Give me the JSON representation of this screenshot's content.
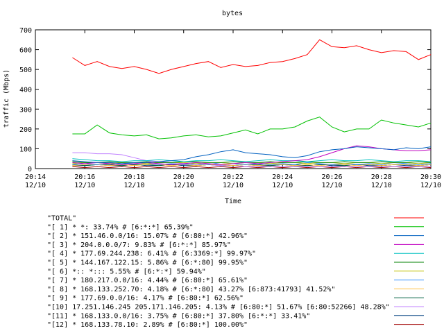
{
  "chart_data": {
    "type": "line",
    "title": "bytes",
    "xlabel": "Time",
    "ylabel": "traffic (Mbps)",
    "ylim": [
      0,
      700
    ],
    "yticks": [
      0,
      100,
      200,
      300,
      400,
      500,
      600,
      700
    ],
    "xlim": [
      "20:14 12/10",
      "20:30 12/10"
    ],
    "xticks": [
      {
        "time": "20:14",
        "date": "12/10"
      },
      {
        "time": "20:16",
        "date": "12/10"
      },
      {
        "time": "20:18",
        "date": "12/10"
      },
      {
        "time": "20:20",
        "date": "12/10"
      },
      {
        "time": "20:22",
        "date": "12/10"
      },
      {
        "time": "20:24",
        "date": "12/10"
      },
      {
        "time": "20:26",
        "date": "12/10"
      },
      {
        "time": "20:28",
        "date": "12/10"
      },
      {
        "time": "20:30",
        "date": "12/10"
      }
    ],
    "grid": false,
    "legend_position": "bottom",
    "series": [
      {
        "name": "\"TOTAL\"",
        "color": "#ff0000",
        "x": [
          "20:15:30",
          "20:16:00",
          "20:16:30",
          "20:17:00",
          "20:17:30",
          "20:18:00",
          "20:18:30",
          "20:19:00",
          "20:19:30",
          "20:20:00",
          "20:20:30",
          "20:21:00",
          "20:21:30",
          "20:22:00",
          "20:22:30",
          "20:23:00",
          "20:23:30",
          "20:24:00",
          "20:24:30",
          "20:25:00",
          "20:25:30",
          "20:26:00",
          "20:26:30",
          "20:27:00",
          "20:27:30",
          "20:28:00",
          "20:28:30",
          "20:29:00",
          "20:29:30",
          "20:30:00"
        ],
        "values": [
          560,
          520,
          540,
          515,
          505,
          515,
          500,
          480,
          500,
          515,
          530,
          540,
          510,
          525,
          515,
          520,
          535,
          540,
          555,
          575,
          650,
          615,
          610,
          620,
          600,
          585,
          595,
          590,
          550,
          575
        ]
      },
      {
        "name": "\"[ 1] * *: 33.74% # [6:*:*] 65.39%\"",
        "color": "#00c000",
        "x": [
          "20:15:30",
          "20:16:00",
          "20:16:30",
          "20:17:00",
          "20:17:30",
          "20:18:00",
          "20:18:30",
          "20:19:00",
          "20:19:30",
          "20:20:00",
          "20:20:30",
          "20:21:00",
          "20:21:30",
          "20:22:00",
          "20:22:30",
          "20:23:00",
          "20:23:30",
          "20:24:00",
          "20:24:30",
          "20:25:00",
          "20:25:30",
          "20:26:00",
          "20:26:30",
          "20:27:00",
          "20:27:30",
          "20:28:00",
          "20:28:30",
          "20:29:00",
          "20:29:30",
          "20:30:00"
        ],
        "values": [
          175,
          175,
          220,
          180,
          170,
          165,
          170,
          150,
          155,
          165,
          170,
          160,
          165,
          180,
          195,
          175,
          200,
          200,
          210,
          240,
          260,
          210,
          185,
          200,
          200,
          245,
          230,
          220,
          210,
          230
        ]
      },
      {
        "name": "\"[ 2] * 151.46.0.0/16: 15.07% # [6:80:*] 42.96%\"",
        "color": "#0060c0",
        "x": [
          "20:15:30",
          "20:16:00",
          "20:16:30",
          "20:17:00",
          "20:17:30",
          "20:18:00",
          "20:18:30",
          "20:19:00",
          "20:19:30",
          "20:20:00",
          "20:20:30",
          "20:21:00",
          "20:21:30",
          "20:22:00",
          "20:22:30",
          "20:23:00",
          "20:23:30",
          "20:24:00",
          "20:24:30",
          "20:25:00",
          "20:25:30",
          "20:26:00",
          "20:26:30",
          "20:27:00",
          "20:27:30",
          "20:28:00",
          "20:28:30",
          "20:29:00",
          "20:29:30",
          "20:30:00"
        ],
        "values": [
          40,
          35,
          30,
          30,
          25,
          30,
          30,
          35,
          40,
          45,
          60,
          70,
          85,
          95,
          80,
          75,
          70,
          60,
          55,
          65,
          85,
          95,
          100,
          110,
          105,
          100,
          95,
          105,
          100,
          110
        ]
      },
      {
        "name": "\"[ 3] * 204.0.0.0/7: 9.83% # [6:*:*] 85.97%\"",
        "color": "#c000c0",
        "x": [
          "20:15:30",
          "20:16:00",
          "20:16:30",
          "20:17:00",
          "20:17:30",
          "20:18:00",
          "20:18:30",
          "20:19:00",
          "20:19:30",
          "20:20:00",
          "20:20:30",
          "20:21:00",
          "20:21:30",
          "20:22:00",
          "20:22:30",
          "20:23:00",
          "20:23:30",
          "20:24:00",
          "20:24:30",
          "20:25:00",
          "20:25:30",
          "20:26:00",
          "20:26:30",
          "20:27:00",
          "20:27:30",
          "20:28:00",
          "20:28:30",
          "20:29:00",
          "20:29:30",
          "20:30:00"
        ],
        "values": [
          30,
          25,
          30,
          25,
          20,
          25,
          30,
          25,
          20,
          25,
          30,
          25,
          20,
          25,
          30,
          25,
          30,
          35,
          40,
          45,
          60,
          80,
          100,
          115,
          110,
          100,
          95,
          90,
          90,
          95
        ]
      },
      {
        "name": "\"[ 4] * 177.69.244.238: 6.41% # [6:3369:*] 99.97%\"",
        "color": "#00c0c0",
        "x": [
          "20:15:30",
          "20:16:00",
          "20:16:30",
          "20:17:00",
          "20:17:30",
          "20:18:00",
          "20:18:30",
          "20:19:00",
          "20:19:30",
          "20:20:00",
          "20:20:30",
          "20:21:00",
          "20:21:30",
          "20:22:00",
          "20:22:30",
          "20:23:00",
          "20:23:30",
          "20:24:00",
          "20:24:30",
          "20:25:00",
          "20:25:30",
          "20:26:00",
          "20:26:30",
          "20:27:00",
          "20:27:30",
          "20:28:00",
          "20:28:30",
          "20:29:00",
          "20:29:30",
          "20:30:00"
        ],
        "values": [
          50,
          45,
          40,
          40,
          35,
          40,
          40,
          45,
          40,
          35,
          40,
          40,
          45,
          40,
          35,
          40,
          45,
          40,
          40,
          35,
          40,
          45,
          40,
          40,
          45,
          40,
          35,
          40,
          40,
          35
        ]
      },
      {
        "name": "\"[ 5] * 144.167.122.15: 5.86% # [6:*:80] 99.95%\"",
        "color": "#008000",
        "x": [
          "20:15:30",
          "20:16:00",
          "20:16:30",
          "20:17:00",
          "20:17:30",
          "20:18:00",
          "20:18:30",
          "20:19:00",
          "20:19:30",
          "20:20:00",
          "20:20:30",
          "20:21:00",
          "20:21:30",
          "20:22:00",
          "20:22:30",
          "20:23:00",
          "20:23:30",
          "20:24:00",
          "20:24:30",
          "20:25:00",
          "20:25:30",
          "20:26:00",
          "20:26:30",
          "20:27:00",
          "20:27:30",
          "20:28:00",
          "20:28:30",
          "20:29:00",
          "20:29:30",
          "20:30:00"
        ],
        "values": [
          35,
          30,
          30,
          35,
          30,
          30,
          35,
          30,
          30,
          35,
          35,
          30,
          30,
          35,
          30,
          30,
          35,
          30,
          30,
          35,
          30,
          30,
          35,
          30,
          30,
          35,
          30,
          30,
          35,
          30
        ]
      },
      {
        "name": "\"[ 6] *:: *::: 5.55% # [6:*:*] 59.94%\"",
        "color": "#c0c000",
        "x": [
          "20:15:30",
          "20:16:00",
          "20:16:30",
          "20:17:00",
          "20:17:30",
          "20:18:00",
          "20:18:30",
          "20:19:00",
          "20:19:30",
          "20:20:00",
          "20:20:30",
          "20:21:00",
          "20:21:30",
          "20:22:00",
          "20:22:30",
          "20:23:00",
          "20:23:30",
          "20:24:00",
          "20:24:30",
          "20:25:00",
          "20:25:30",
          "20:26:00",
          "20:26:30",
          "20:27:00",
          "20:27:30",
          "20:28:00",
          "20:28:30",
          "20:29:00",
          "20:29:30",
          "20:30:00"
        ],
        "values": [
          25,
          30,
          30,
          25,
          30,
          30,
          25,
          30,
          30,
          30,
          25,
          30,
          30,
          25,
          30,
          30,
          25,
          30,
          30,
          25,
          30,
          30,
          25,
          30,
          30,
          25,
          30,
          30,
          25,
          30
        ]
      },
      {
        "name": "\"[ 7] * 180.217.0.0/16: 4.44% # [6:80:*] 65.61%\"",
        "color": "#3090ff",
        "x": [
          "20:15:30",
          "20:16:00",
          "20:16:30",
          "20:17:00",
          "20:17:30",
          "20:18:00",
          "20:18:30",
          "20:19:00",
          "20:19:30",
          "20:20:00",
          "20:20:30",
          "20:21:00",
          "20:21:30",
          "20:22:00",
          "20:22:30",
          "20:23:00",
          "20:23:30",
          "20:24:00",
          "20:24:30",
          "20:25:00",
          "20:25:30",
          "20:26:00",
          "20:26:30",
          "20:27:00",
          "20:27:30",
          "20:28:00",
          "20:28:30",
          "20:29:00",
          "20:29:30",
          "20:30:00"
        ],
        "values": [
          20,
          25,
          20,
          25,
          20,
          30,
          25,
          20,
          25,
          20,
          25,
          20,
          30,
          25,
          20,
          25,
          20,
          25,
          20,
          30,
          25,
          20,
          25,
          20,
          25,
          20,
          30,
          25,
          20,
          25
        ]
      },
      {
        "name": "\"[ 8] * 168.133.252.70: 4.18% # [6:*:80] 43.27% [6:873:41793] 41.52%\"",
        "color": "#ffc040",
        "x": [
          "20:15:30",
          "20:16:00",
          "20:16:30",
          "20:17:00",
          "20:17:30",
          "20:18:00",
          "20:18:30",
          "20:19:00",
          "20:19:30",
          "20:20:00",
          "20:20:30",
          "20:21:00",
          "20:21:30",
          "20:22:00",
          "20:22:30",
          "20:23:00",
          "20:23:30",
          "20:24:00",
          "20:24:30",
          "20:25:00",
          "20:25:30",
          "20:26:00",
          "20:26:30",
          "20:27:00",
          "20:27:30",
          "20:28:00",
          "20:28:30",
          "20:29:00",
          "20:29:30",
          "20:30:00"
        ],
        "values": [
          15,
          20,
          20,
          15,
          20,
          15,
          20,
          20,
          15,
          20,
          15,
          20,
          20,
          15,
          20,
          15,
          20,
          20,
          15,
          20,
          15,
          20,
          20,
          15,
          20,
          15,
          20,
          20,
          15,
          20
        ]
      },
      {
        "name": "\"[ 9] * 177.69.0.0/16: 4.17% # [6:80:*] 62.56%\"",
        "color": "#006040",
        "x": [
          "20:15:30",
          "20:16:00",
          "20:16:30",
          "20:17:00",
          "20:17:30",
          "20:18:00",
          "20:18:30",
          "20:19:00",
          "20:19:30",
          "20:20:00",
          "20:20:30",
          "20:21:00",
          "20:21:30",
          "20:22:00",
          "20:22:30",
          "20:23:00",
          "20:23:30",
          "20:24:00",
          "20:24:30",
          "20:25:00",
          "20:25:30",
          "20:26:00",
          "20:26:30",
          "20:27:00",
          "20:27:30",
          "20:28:00",
          "20:28:30",
          "20:29:00",
          "20:29:30",
          "20:30:00"
        ],
        "values": [
          20,
          15,
          20,
          20,
          15,
          20,
          20,
          15,
          20,
          20,
          15,
          20,
          20,
          15,
          20,
          20,
          15,
          20,
          20,
          15,
          20,
          20,
          15,
          20,
          20,
          15,
          20,
          20,
          15,
          20
        ]
      },
      {
        "name": "\"[10] 17.251.146.245 205.171.146.205: 4.13% # [6:80:*] 51.67% [6:80:52266] 48.28%\"",
        "color": "#c080ff",
        "x": [
          "20:15:30",
          "20:16:00",
          "20:16:30",
          "20:17:00",
          "20:17:30",
          "20:18:00",
          "20:18:30",
          "20:19:00",
          "20:19:30",
          "20:20:00",
          "20:20:30",
          "20:21:00",
          "20:21:30",
          "20:22:00",
          "20:22:30",
          "20:23:00",
          "20:23:30",
          "20:24:00",
          "20:24:30",
          "20:25:00",
          "20:25:30",
          "20:26:00",
          "20:26:30",
          "20:27:00",
          "20:27:30",
          "20:28:00",
          "20:28:30",
          "20:29:00",
          "20:29:30",
          "20:30:00"
        ],
        "values": [
          80,
          80,
          75,
          75,
          70,
          55,
          40,
          35,
          30,
          25,
          20,
          20,
          15,
          15,
          10,
          10,
          10,
          10,
          10,
          10,
          10,
          10,
          10,
          10,
          10,
          10,
          10,
          10,
          10,
          10
        ]
      },
      {
        "name": "\"[11] * 168.133.0.0/16: 3.75% # [6:80:*] 37.80% [6:*:*] 33.41%\"",
        "color": "#004080",
        "x": [
          "20:15:30",
          "20:16:00",
          "20:16:30",
          "20:17:00",
          "20:17:30",
          "20:18:00",
          "20:18:30",
          "20:19:00",
          "20:19:30",
          "20:20:00",
          "20:20:30",
          "20:21:00",
          "20:21:30",
          "20:22:00",
          "20:22:30",
          "20:23:00",
          "20:23:30",
          "20:24:00",
          "20:24:30",
          "20:25:00",
          "20:25:30",
          "20:26:00",
          "20:26:30",
          "20:27:00",
          "20:27:30",
          "20:28:00",
          "20:28:30",
          "20:29:00",
          "20:29:30",
          "20:30:00"
        ],
        "values": [
          15,
          15,
          20,
          15,
          15,
          20,
          15,
          15,
          20,
          15,
          15,
          20,
          15,
          15,
          20,
          15,
          15,
          20,
          15,
          15,
          20,
          15,
          15,
          20,
          15,
          15,
          20,
          15,
          15,
          20
        ]
      },
      {
        "name": "\"[12] * 168.133.78.10: 2.89% # [6:80:*] 100.00%\"",
        "color": "#a00000",
        "x": [
          "20:15:30",
          "20:16:00",
          "20:16:30",
          "20:17:00",
          "20:17:30",
          "20:18:00",
          "20:18:30",
          "20:19:00",
          "20:19:30",
          "20:20:00",
          "20:20:30",
          "20:21:00",
          "20:21:30",
          "20:22:00",
          "20:22:30",
          "20:23:00",
          "20:23:30",
          "20:24:00",
          "20:24:30",
          "20:25:00",
          "20:25:30",
          "20:26:00",
          "20:26:30",
          "20:27:00",
          "20:27:30",
          "20:28:00",
          "20:28:30",
          "20:29:00",
          "20:29:30",
          "20:30:00"
        ],
        "values": [
          10,
          5,
          10,
          5,
          10,
          5,
          10,
          5,
          10,
          5,
          10,
          5,
          10,
          5,
          10,
          5,
          10,
          5,
          10,
          5,
          10,
          5,
          10,
          5,
          10,
          5,
          10,
          5,
          10,
          5
        ]
      }
    ]
  }
}
